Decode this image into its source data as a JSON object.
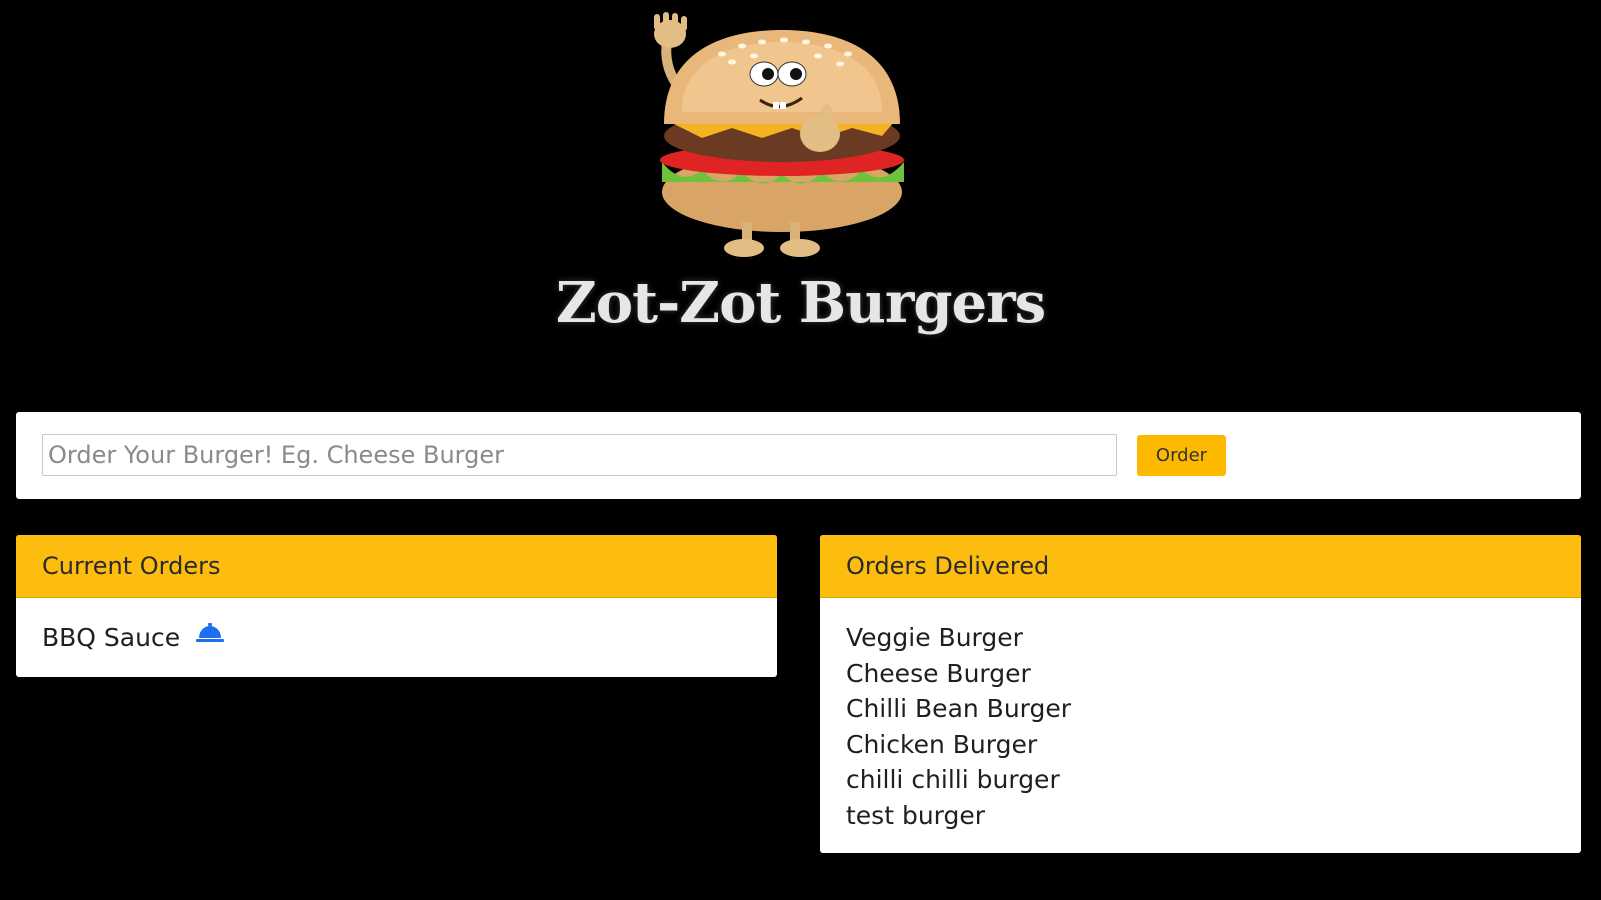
{
  "header": {
    "title": "Zot-Zot Burgers",
    "logo_icon": "burger-mascot-icon"
  },
  "order_form": {
    "input_value": "",
    "input_placeholder": "Order Your Burger! Eg. Cheese Burger",
    "button_label": "Order"
  },
  "current_orders": {
    "title": "Current Orders",
    "items": [
      {
        "label": "BBQ Sauce",
        "action_icon": "service-bell-icon"
      }
    ]
  },
  "orders_delivered": {
    "title": "Orders Delivered",
    "items": [
      "Veggie Burger",
      "Cheese Burger",
      "Chilli Bean Burger",
      "Chicken Burger",
      "chilli chilli burger",
      "test burger"
    ]
  },
  "colors": {
    "background": "#000000",
    "accent": "#fdbd0e",
    "title": "#e6e6e6",
    "bell": "#1e6ff0"
  }
}
